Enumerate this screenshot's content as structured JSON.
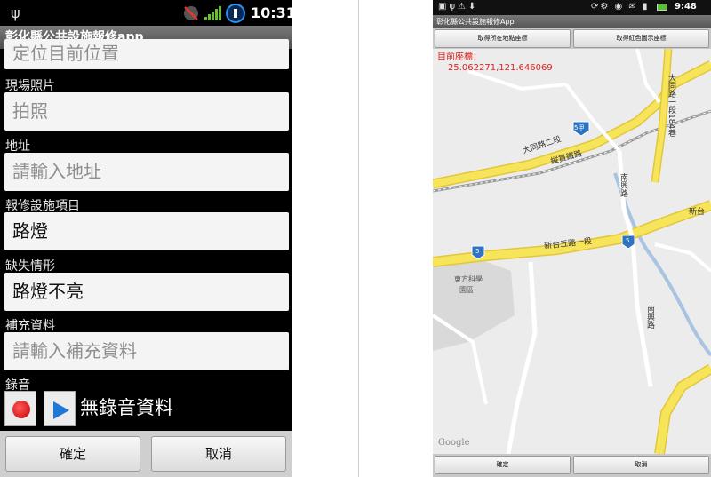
{
  "left": {
    "status": {
      "time": "10:31"
    },
    "title": "彰化縣公共設施報修app",
    "partial_field": "定位目前位置",
    "fields": [
      {
        "label": "現場照片",
        "value": "拍照",
        "kind": "placeholder"
      },
      {
        "label": "地址",
        "value": "請輸入地址",
        "kind": "placeholder"
      },
      {
        "label": "報修設施項目",
        "value": "路燈",
        "kind": "value"
      },
      {
        "label": "缺失情形",
        "value": "路燈不亮",
        "kind": "value"
      },
      {
        "label": "補充資料",
        "value": "請輸入補充資料",
        "kind": "placeholder"
      }
    ],
    "recording_label": "錄音",
    "no_recording": "無錄音資料",
    "confirm": "確定",
    "cancel": "取消"
  },
  "right": {
    "status": {
      "time": "9:48"
    },
    "title": "彰化縣公共設施報修App",
    "get_location_button": "取得所在地點座標",
    "get_marker_button": "取得紅色圖示座標",
    "coord_label": "目前座標：",
    "coord_value": "25.062271,121.646069",
    "map_labels": {
      "road_a": "大同路二段",
      "road_b": "縱貫鐵路",
      "road_c": "新台五路一段",
      "road_d": "大同路一段184巷",
      "road_e": "南興路",
      "road_f": "新台",
      "campus": "東方科學",
      "campus2": "園區",
      "shield_5a": "5甲",
      "shield_5": "5",
      "google": "Google"
    },
    "confirm": "確定",
    "cancel": "取消"
  },
  "colors": {
    "road": "#f6e45a",
    "road_edge": "#e3c63a",
    "river": "#a9c4e0",
    "campus": "#d8d8d8",
    "coord_text": "#e02020"
  }
}
